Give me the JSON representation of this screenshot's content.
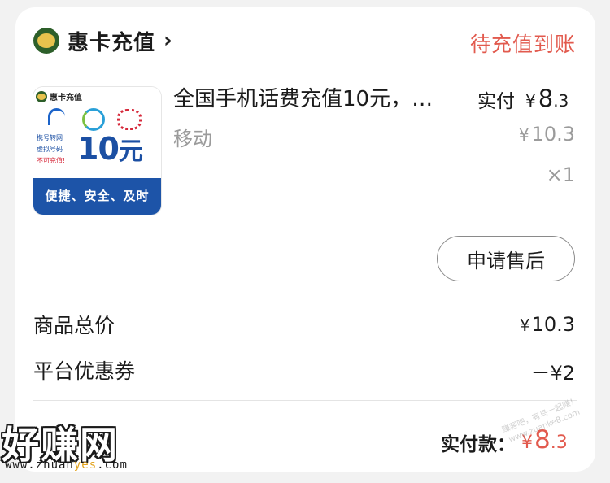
{
  "shop": {
    "name": "惠卡充值",
    "chevron": "›"
  },
  "order": {
    "status": "待充值到账"
  },
  "product": {
    "thumbnail": {
      "brand": "惠卡充值",
      "note_1": "携号转网",
      "note_2": "虚拟号码",
      "note_3": "不可充值!",
      "amount": "10",
      "amount_unit": "元",
      "slogan": "便捷、安全、及时"
    },
    "title": "全国手机话费充值10元，…",
    "sku": "移动",
    "paid_label": "实付",
    "paid_currency": "¥",
    "paid_int": "8",
    "paid_dec": ".3",
    "original_currency": "¥",
    "original_price": "10.3",
    "quantity": "×1"
  },
  "actions": {
    "after_sale": "申请售后"
  },
  "summary": {
    "goods_total_label": "商品总价",
    "goods_total_currency": "¥",
    "goods_total_value": "10.3",
    "coupon_label": "平台优惠券",
    "coupon_value": "－¥2"
  },
  "total": {
    "label": "实付款：",
    "currency": "¥",
    "int": "8",
    "dec": ".3"
  },
  "watermark": {
    "logo": "好赚网",
    "url_pre": "www.zhuan",
    "url_accent": "yes",
    "url_post": ".com",
    "stamp_line1": "赚客吧，有鸟一起赚！",
    "stamp_line2": "www.zuanke8.com"
  },
  "colors": {
    "accent": "#e25a4e",
    "muted": "#9b9b9b",
    "thumb_blue": "#1d54a8"
  }
}
